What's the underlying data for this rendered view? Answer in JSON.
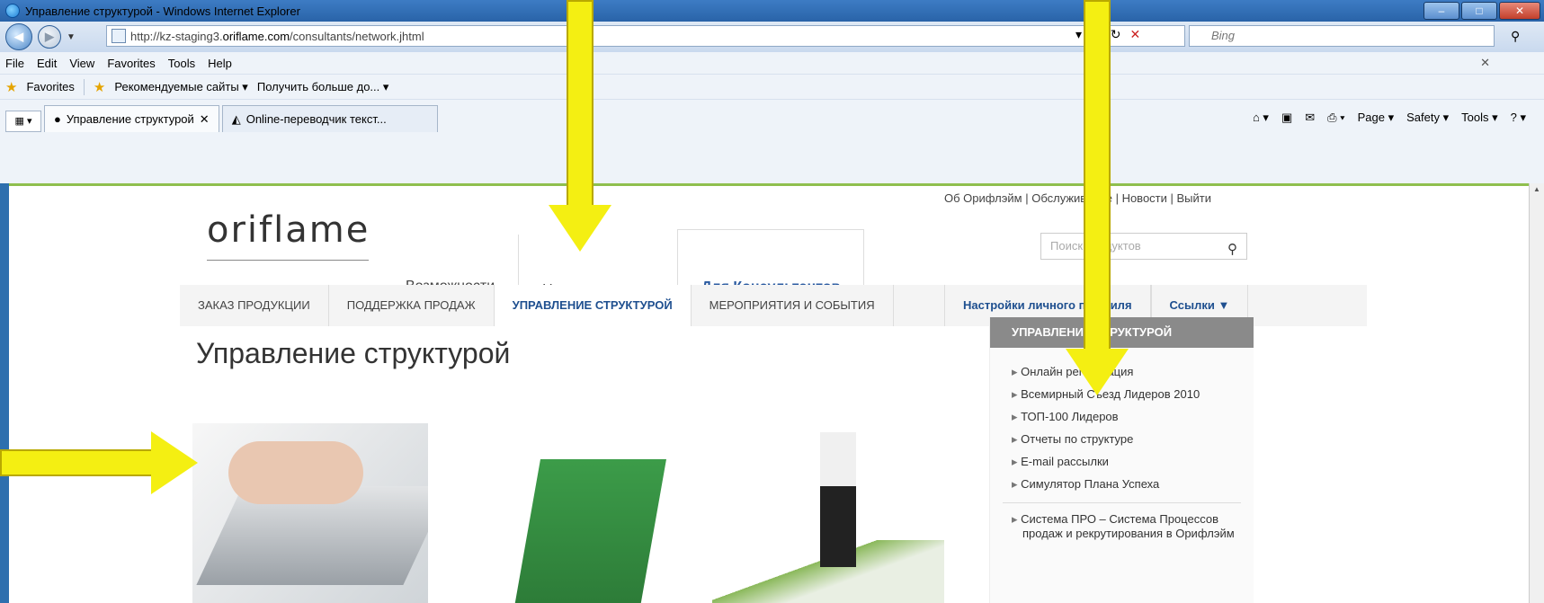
{
  "window": {
    "title": "Управление структурой - Windows Internet Explorer",
    "url_prefix": "http://kz-staging3.",
    "url_domain": "oriflame.com",
    "url_suffix": "/consultants/network.jhtml",
    "search_placeholder": "Bing"
  },
  "menubar": {
    "items": [
      "File",
      "Edit",
      "View",
      "Favorites",
      "Tools",
      "Help"
    ]
  },
  "favorites": {
    "label": "Favorites",
    "items": [
      "Рекомендуемые сайты ▾",
      "Получить больше до... ▾"
    ]
  },
  "tabs": [
    {
      "label": "Управление структурой"
    },
    {
      "label": "Online-переводчик текст..."
    }
  ],
  "commandbar": {
    "items": [
      "Page ▾",
      "Safety ▾",
      "Tools ▾"
    ]
  },
  "site": {
    "logo": "oriflame",
    "nav": [
      "Возможности",
      "Наша продукция",
      "Для Консультантов"
    ],
    "toplinks": "Об Орифлэйм | Обслуживание | Новости | Выйти",
    "search_placeholder": "Поиск продуктов",
    "subnav": [
      "ЗАКАЗ ПРОДУКЦИИ",
      "ПОДДЕРЖКА ПРОДАЖ",
      "УПРАВЛЕНИЕ СТРУКТУРОЙ",
      "МЕРОПРИЯТИЯ И СОБЫТИЯ"
    ],
    "subnav_right": [
      "Настройки личного профиля",
      "Ссылки ▼"
    ],
    "page_title": "Управление структурой",
    "sidebar": {
      "header": "УПРАВЛЕНИЕ СТРУКТУРОЙ",
      "items": [
        "Онлайн регистрация",
        "Всемирный Съезд Лидеров 2010",
        "ТОП-100 Лидеров",
        "Отчеты по структуре",
        "E-mail рассылки",
        "Симулятор Плана Успеха"
      ],
      "extra": "Система ПРО – Система Процессов продаж и рекрутирования в Орифлэйм"
    }
  }
}
